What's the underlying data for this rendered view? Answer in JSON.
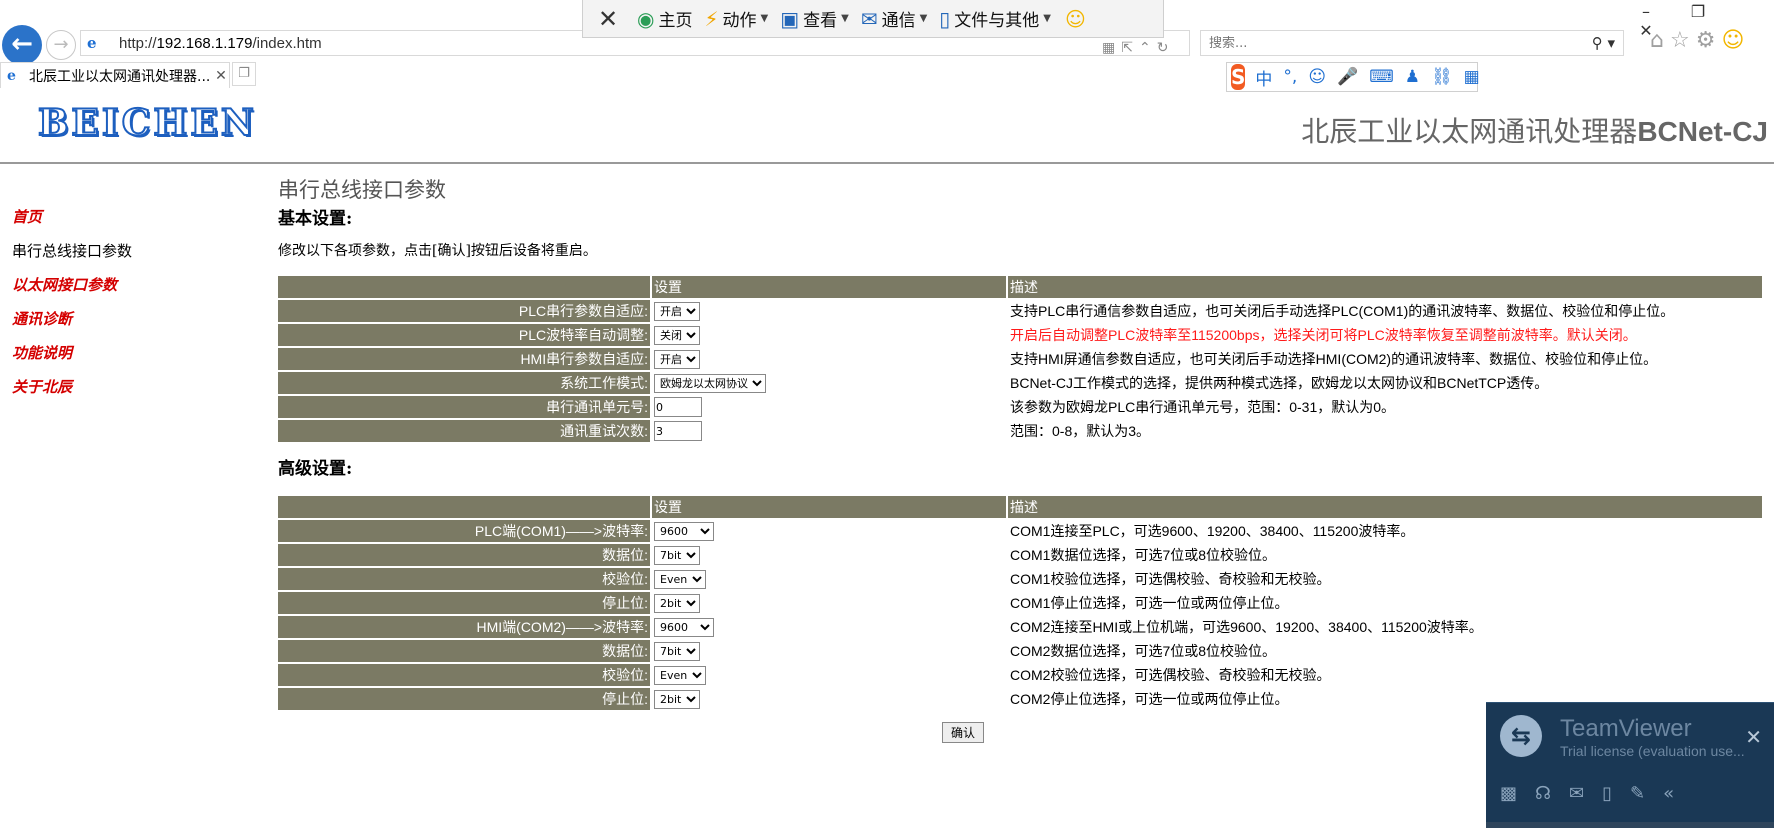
{
  "browser": {
    "url_scheme": "http://",
    "url_host": "192.168.1.179",
    "url_path": "/index.htm",
    "search_placeholder": "搜索...",
    "tab_title": "北辰工业以太网通讯处理器..."
  },
  "toolbar": {
    "home": "主页",
    "action": "动作",
    "view": "查看",
    "comm": "通信",
    "files": "文件与其他"
  },
  "ime": {
    "logo": "S",
    "mode": "中"
  },
  "header": {
    "logo": "BEICHEN",
    "title_cn": "北辰工业以太网通讯处理器",
    "title_en": "BCNet-CJ"
  },
  "sidebar": {
    "items": [
      {
        "label": "首页",
        "current": false
      },
      {
        "label": "串行总线接口参数",
        "current": true
      },
      {
        "label": "以太网接口参数",
        "current": false
      },
      {
        "label": "通讯诊断",
        "current": false
      },
      {
        "label": "功能说明",
        "current": false
      },
      {
        "label": "关于北辰",
        "current": false
      }
    ]
  },
  "main": {
    "page_heading": "串行总线接口参数",
    "basic_heading": "基本设置:",
    "notice": "修改以下各项参数，点击[确认]按钮后设备将重启。",
    "col_setting": "设置",
    "col_desc": "描述",
    "basic_rows": [
      {
        "label": "PLC串行参数自适应:",
        "value": "开启",
        "desc": "支持PLC串行通信参数自适应，也可关闭后手动选择PLC(COM1)的通讯波特率、数据位、校验位和停止位。"
      },
      {
        "label": "PLC波特率自动调整:",
        "value": "关闭",
        "desc": "开启后自动调整PLC波特率至115200bps，选择关闭可将PLC波特率恢复至调整前波特率。默认关闭。"
      },
      {
        "label": "HMI串行参数自适应:",
        "value": "开启",
        "desc": "支持HMI屏通信参数自适应，也可关闭后手动选择HMI(COM2)的通讯波特率、数据位、校验位和停止位。"
      },
      {
        "label": "系统工作模式:",
        "value": "欧姆龙以太网协议",
        "desc": "BCNet-CJ工作模式的选择，提供两种模式选择，欧姆龙以太网协议和BCNetTCP透传。"
      },
      {
        "label": "串行通讯单元号:",
        "value": "0",
        "desc": "该参数为欧姆龙PLC串行通讯单元号，范围：0-31，默认为0。"
      },
      {
        "label": "通讯重试次数:",
        "value": "3",
        "desc": "范围：0-8，默认为3。"
      }
    ],
    "advanced_heading": "高级设置:",
    "advanced_rows": [
      {
        "label": "PLC端(COM1)——>波特率:",
        "value": "9600",
        "desc": "COM1连接至PLC，可选9600、19200、38400、115200波特率。"
      },
      {
        "label": "数据位:",
        "value": "7bit",
        "desc": "COM1数据位选择，可选7位或8位校验位。"
      },
      {
        "label": "校验位:",
        "value": "Even",
        "desc": "COM1校验位选择，可选偶校验、奇校验和无校验。"
      },
      {
        "label": "停止位:",
        "value": "2bit",
        "desc": "COM1停止位选择，可选一位或两位停止位。"
      },
      {
        "label": "HMI端(COM2)——>波特率:",
        "value": "9600",
        "desc": "COM2连接至HMI或上位机端，可选9600、19200、38400、115200波特率。"
      },
      {
        "label": "数据位:",
        "value": "7bit",
        "desc": "COM2数据位选择，可选7位或8位校验位。"
      },
      {
        "label": "校验位:",
        "value": "Even",
        "desc": "COM2校验位选择，可选偶校验、奇校验和无校验。"
      },
      {
        "label": "停止位:",
        "value": "2bit",
        "desc": "COM2停止位选择，可选一位或两位停止位。"
      }
    ],
    "confirm": "确认"
  },
  "teamviewer": {
    "name": "TeamViewer",
    "license": "Trial license (evaluation use..."
  },
  "colors": {
    "label_bg": "#7b7a64",
    "nav_link": "#d40000",
    "warn_text": "#ff1a1a",
    "logo_blue": "#1d5fbf",
    "tv_bg": "#1a3855"
  }
}
